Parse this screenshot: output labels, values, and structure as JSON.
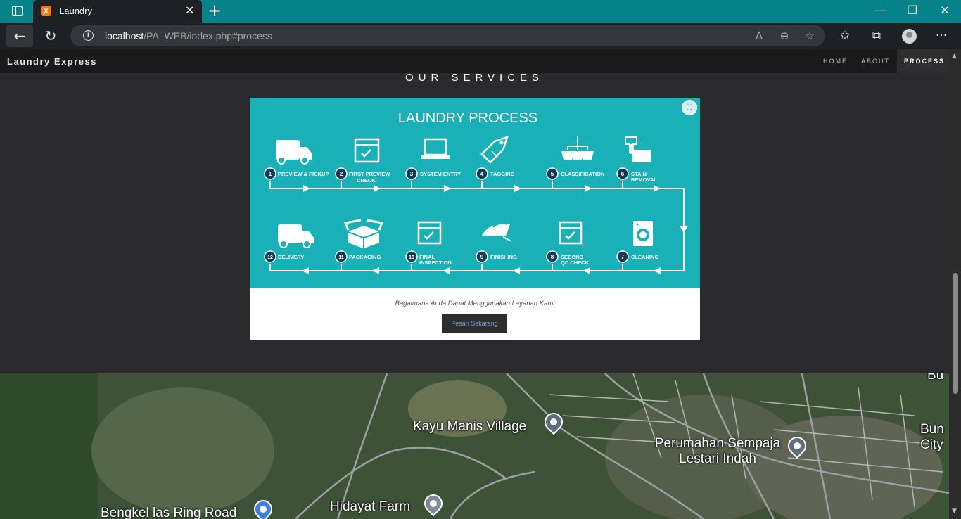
{
  "browser": {
    "tab_title": "Laundry",
    "tab_icon": "xampp-icon",
    "new_tab_label": "+",
    "url_host": "localhost",
    "url_path": "/PA_WEB/index.php#process",
    "accent_color": "#06828a"
  },
  "site": {
    "brand": "Laundry Express",
    "nav": [
      {
        "label": "HOME",
        "active": false
      },
      {
        "label": "ABOUT",
        "active": false
      },
      {
        "label": "PROCESS",
        "active": true
      }
    ],
    "section_title": "OUR SERVICES"
  },
  "process": {
    "title": "LAUNDRY PROCESS",
    "steps": [
      {
        "num": "1",
        "label": "PREVIEW & PICKUP",
        "icon": "van-icon"
      },
      {
        "num": "2",
        "label": "FIRST PREVIEW CHECK",
        "icon": "checklist-icon"
      },
      {
        "num": "3",
        "label": "SYSTEM ENTRY",
        "icon": "laptop-icon"
      },
      {
        "num": "4",
        "label": "TAGGING",
        "icon": "tag-icon"
      },
      {
        "num": "5",
        "label": "CLASSIFICATION",
        "icon": "baskets-icon"
      },
      {
        "num": "6",
        "label": "STAIN REMOVAL",
        "icon": "spray-icon"
      },
      {
        "num": "7",
        "label": "CLEANING",
        "icon": "washing-machine-icon"
      },
      {
        "num": "8",
        "label": "SECOND QC CHECK",
        "icon": "checklist-icon"
      },
      {
        "num": "9",
        "label": "FINISHING",
        "icon": "iron-icon"
      },
      {
        "num": "10",
        "label": "FINAL INSPECTION",
        "icon": "checklist-icon"
      },
      {
        "num": "11",
        "label": "PACKAGING",
        "icon": "box-icon"
      },
      {
        "num": "12",
        "label": "DELIVERY",
        "icon": "van-icon"
      }
    ],
    "caption": "Bagaimana Anda Dapat Menggunakan Layanan Kami",
    "button_label": "Pesan Sekarang",
    "bg_color": "#1ab0b8"
  },
  "map": {
    "labels": [
      {
        "text": "Kayu Manis Village",
        "pin": "museum-pin"
      },
      {
        "text": "Perumahan Sempaja Lestari Indah",
        "pin": "museum-pin"
      },
      {
        "text": "Hidayat Farm",
        "pin": "place-pin"
      },
      {
        "text": "Bengkel las Ring Road",
        "pin": "shopping-pin"
      },
      {
        "text": "Bun City",
        "pin": ""
      },
      {
        "text": "Bu",
        "pin": ""
      }
    ]
  }
}
